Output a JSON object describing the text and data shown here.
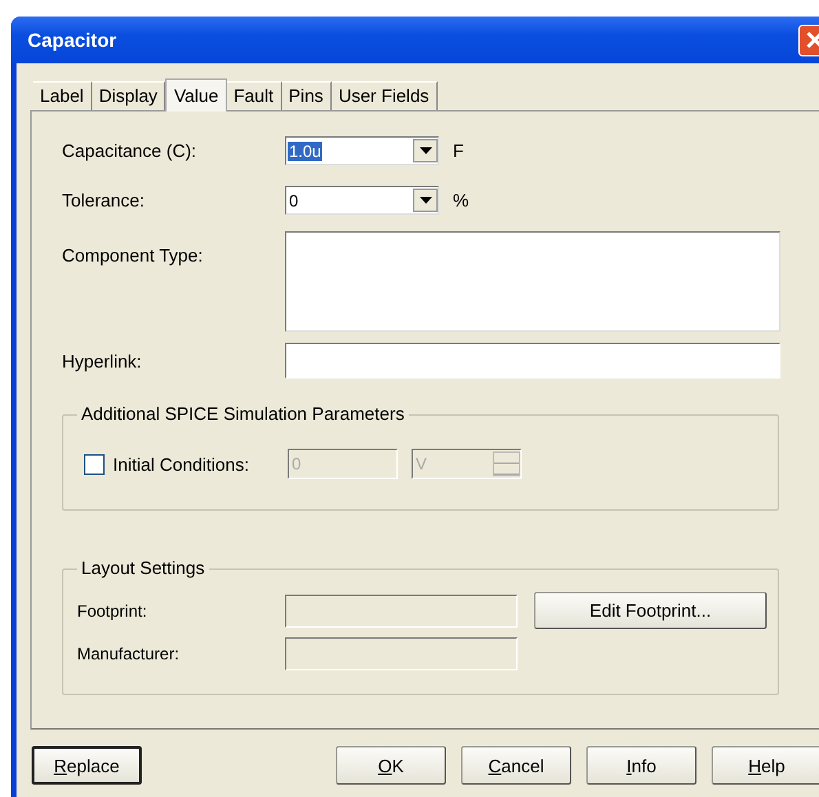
{
  "window": {
    "title": "Capacitor"
  },
  "tabs": [
    {
      "label": "Label",
      "selected": false
    },
    {
      "label": "Display",
      "selected": false
    },
    {
      "label": "Value",
      "selected": true
    },
    {
      "label": "Fault",
      "selected": false
    },
    {
      "label": "Pins",
      "selected": false
    },
    {
      "label": "User Fields",
      "selected": false
    }
  ],
  "capacitance": {
    "label": "Capacitance (C):",
    "value": "1.0u",
    "unit": "F"
  },
  "tolerance": {
    "label": "Tolerance:",
    "value": "0",
    "unit": "%"
  },
  "component_type": {
    "label": "Component Type:"
  },
  "hyperlink": {
    "label": "Hyperlink:"
  },
  "spice": {
    "title": "Additional SPICE Simulation Parameters",
    "initial_conditions": {
      "label": "Initial Conditions:",
      "checked": false,
      "disabled": true,
      "value": "0",
      "unit": "V"
    }
  },
  "layout": {
    "title": "Layout Settings",
    "footprint_label": "Footprint:",
    "manufacturer_label": "Manufacturer:",
    "edit_button": "Edit Footprint..."
  },
  "buttons": [
    {
      "label": "Replace",
      "default": true
    },
    {
      "label": "OK",
      "default": false
    },
    {
      "label": "Cancel",
      "default": false
    },
    {
      "label": "Info",
      "default": false
    },
    {
      "label": "Help",
      "default": false
    }
  ]
}
